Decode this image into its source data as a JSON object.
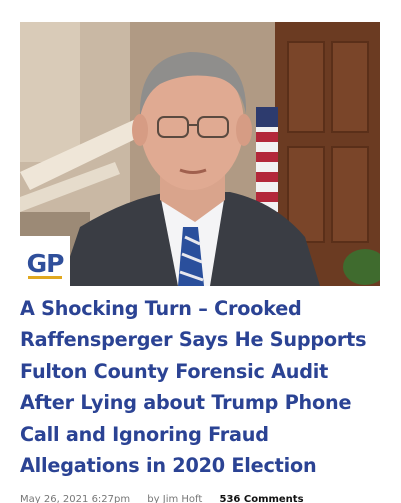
{
  "article": {
    "image_alt": "Man in suit speaking at press conference",
    "headline": "A Shocking Turn – Crooked Raffensperger Says He Supports Fulton County Forensic Audit After Lying about Trump Phone Call and Ignoring Fraud Allegations in 2020 Election",
    "date": "May 26, 2021 6:27pm",
    "by": "by",
    "author": "Jim Hoft",
    "comments": "536 Comments"
  },
  "logo": {
    "text": "GP"
  },
  "colors": {
    "headline": "#2b4394",
    "logo_blue": "#2f4f9b",
    "logo_accent": "#e0a81f"
  }
}
